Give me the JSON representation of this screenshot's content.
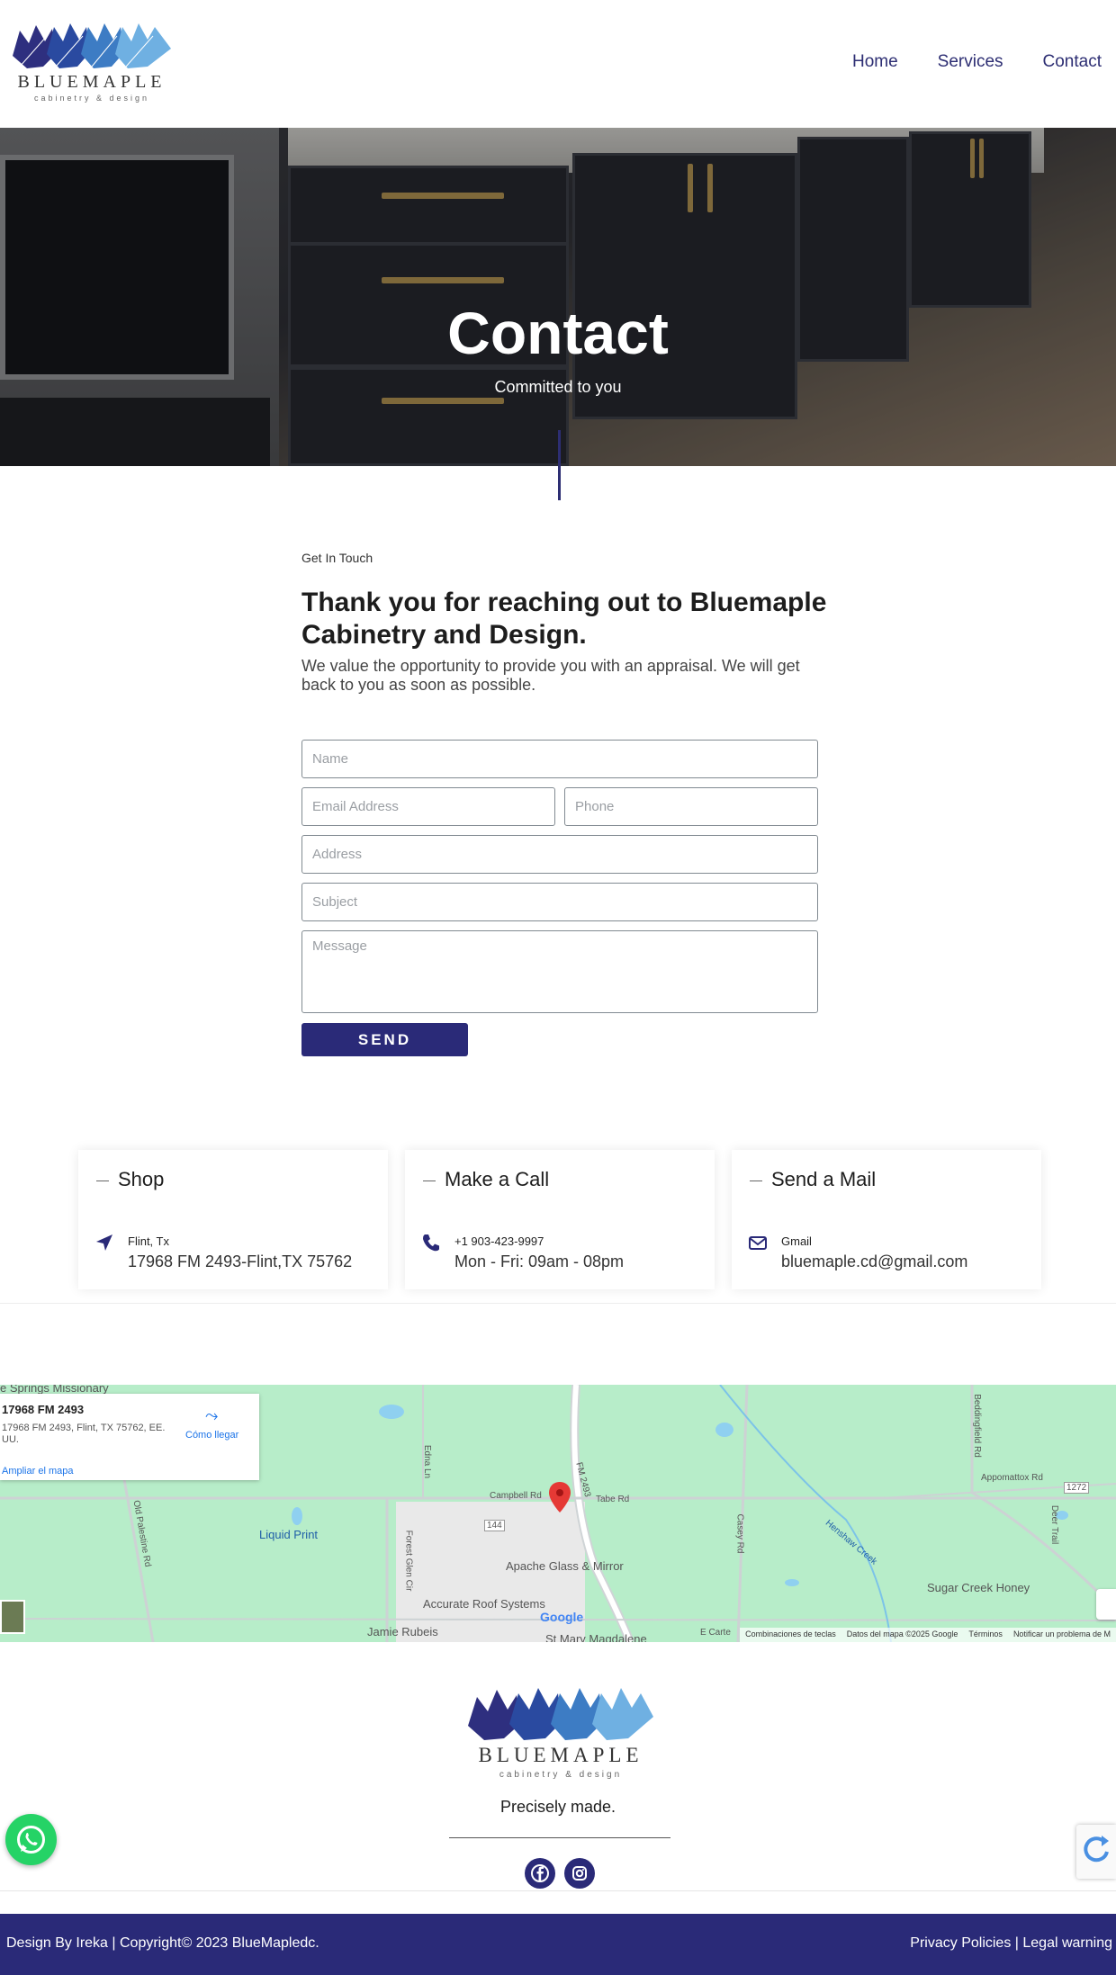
{
  "brand": {
    "name": "BLUEMAPLE",
    "tagline": "cabinetry & design"
  },
  "nav": {
    "items": [
      "Home",
      "Services",
      "Contact"
    ]
  },
  "hero": {
    "title": "Contact",
    "subtitle": "Committed to you"
  },
  "contact": {
    "eyebrow": "Get In Touch",
    "headline": "Thank you for reaching out to Bluemaple Cabinetry and Design.",
    "lead": "We value the opportunity to provide you with an appraisal. We will get back to you as soon as possible.",
    "form": {
      "name_placeholder": "Name",
      "email_placeholder": "Email Address",
      "phone_placeholder": "Phone",
      "address_placeholder": "Address",
      "subject_placeholder": "Subject",
      "message_placeholder": "Message",
      "send_label": "SEND"
    }
  },
  "cards": [
    {
      "title": "Shop",
      "small": "Flint, Tx",
      "big": "17968 FM 2493-Flint,TX 75762",
      "icon": "location-arrow-icon"
    },
    {
      "title": "Make a Call",
      "small": "+1 903-423-9997",
      "big": "Mon - Fri: 09am - 08pm",
      "icon": "phone-icon"
    },
    {
      "title": "Send a Mail",
      "small": "Gmail",
      "big": "bluemaple.cd@gmail.com",
      "icon": "envelope-icon"
    }
  ],
  "map": {
    "card_title": "17968 FM 2493",
    "card_address": "17968 FM 2493, Flint, TX 75762, EE. UU.",
    "enlarge": "Ampliar el mapa",
    "directions": "Cómo llegar",
    "labels": {
      "springs": "e Springs Missionary",
      "liquid_print": "Liquid Print",
      "apache": "Apache Glass & Mirror",
      "accurate": "Accurate Roof Systems",
      "jamie": "Jamie Rubeis",
      "st_mary": "St Mary Magdalene",
      "sugar_creek": "Sugar Creek Honey",
      "campbell": "Campbell Rd",
      "tabe": "Tabe Rd",
      "fm2493": "FM 2493",
      "old_palestine": "Old Palestine Rd",
      "edna": "Edna Ln",
      "forest_glen": "Forest Glen Cir",
      "casey": "Casey Rd",
      "beddingfield": "Beddingfield Rd",
      "appomattox": "Appomattox Rd",
      "deer_trail": "Deer Trail",
      "hemp_creek": "Henshaw Creek",
      "r144": "144",
      "r1272": "1272",
      "e_carte": "E Carte"
    },
    "footer": [
      "Combinaciones de teclas",
      "Datos del mapa ©2025 Google",
      "Términos",
      "Notificar un problema de M"
    ],
    "google": "Google"
  },
  "footer": {
    "tagline": "Precisely made.",
    "credit": "Design By Ireka | Copyright© 2023 BlueMapledc.",
    "legal": "Privacy Policies | Legal warning"
  },
  "colors": {
    "accent": "#2a2a78",
    "whatsapp": "#25d366"
  }
}
